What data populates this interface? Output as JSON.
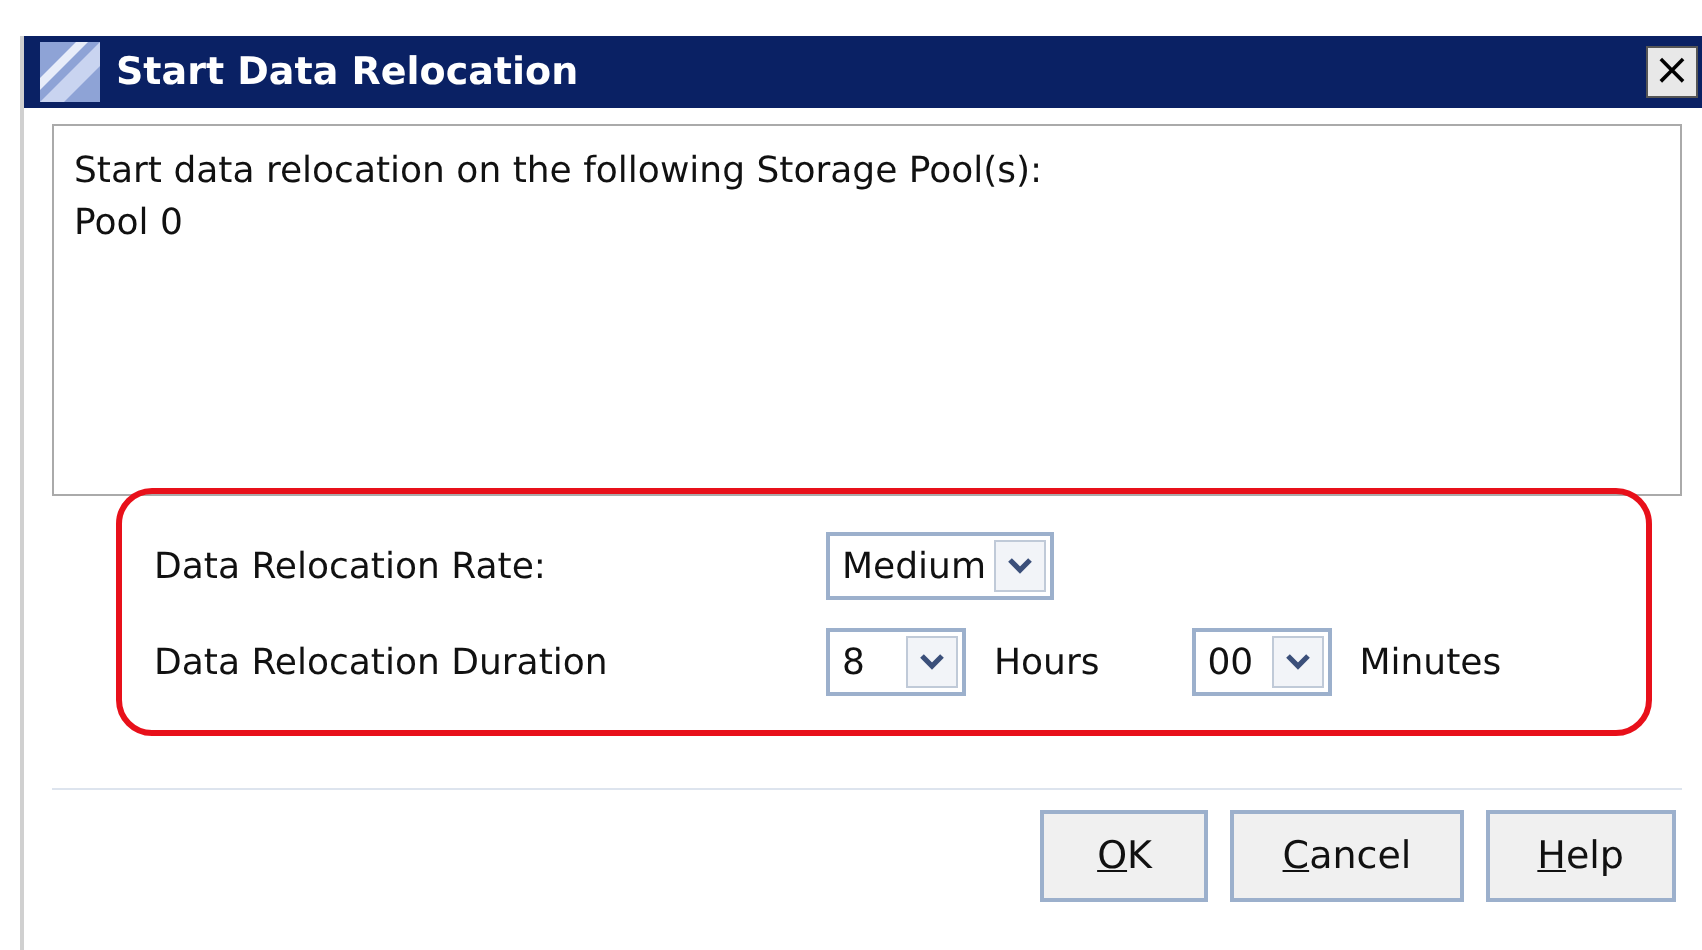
{
  "window": {
    "title": "Start Data Relocation",
    "close_label": "×"
  },
  "message": [
    "Start data relocation on the following Storage Pool(s):",
    "Pool 0"
  ],
  "settings": [
    {
      "label": "Data Relocation Rate:",
      "fields": [
        {
          "value": "Medium"
        }
      ]
    },
    {
      "label": "Data Relocation Duration",
      "fields": [
        {
          "value": "8",
          "unit": "Hours"
        },
        {
          "value": "00",
          "unit": "Minutes"
        }
      ]
    }
  ],
  "buttons": [
    {
      "label": "OK",
      "access_key_underlined": true
    },
    {
      "label": "Cancel",
      "access_key_underlined": true
    },
    {
      "label": "Help",
      "access_key_underlined": true
    }
  ]
}
